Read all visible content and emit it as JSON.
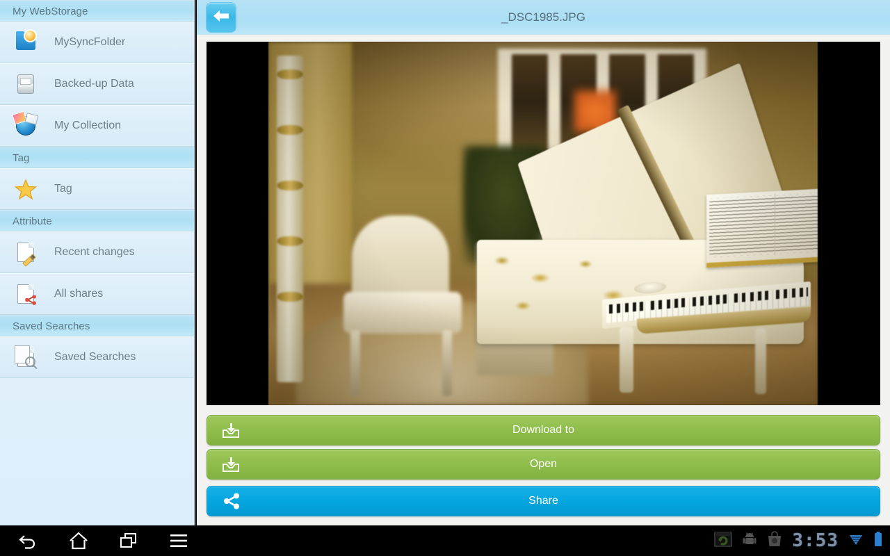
{
  "sidebar": {
    "sections": [
      {
        "title": "My WebStorage",
        "items": [
          {
            "label": "MySyncFolder",
            "icon": "sync-folder-icon"
          },
          {
            "label": "Backed-up Data",
            "icon": "backup-drive-icon"
          },
          {
            "label": "My Collection",
            "icon": "collection-globe-icon"
          }
        ]
      },
      {
        "title": "Tag",
        "items": [
          {
            "label": "Tag",
            "icon": "star-icon"
          }
        ]
      },
      {
        "title": "Attribute",
        "items": [
          {
            "label": "Recent changes",
            "icon": "document-pencil-icon"
          },
          {
            "label": "All shares",
            "icon": "document-share-icon"
          }
        ]
      },
      {
        "title": "Saved Searches",
        "items": [
          {
            "label": "Saved Searches",
            "icon": "document-search-icon"
          }
        ]
      }
    ]
  },
  "header": {
    "back_icon": "arrow-left-icon",
    "title": "_DSC1985.JPG"
  },
  "viewer": {
    "photo_alt": "white grand piano with gold ornamentation and sheet music",
    "letterbox_color": "#000000"
  },
  "actions": [
    {
      "label": "Download to",
      "icon": "download-tray-icon",
      "style": "green",
      "color": "#8fbe4c"
    },
    {
      "label": "Open",
      "icon": "download-tray-icon",
      "style": "green",
      "color": "#8fbe4c"
    },
    {
      "label": "Share",
      "icon": "share-nodes-icon",
      "style": "blue",
      "color": "#05a6e0"
    }
  ],
  "navbar": {
    "buttons": [
      {
        "name": "back-icon"
      },
      {
        "name": "home-icon"
      },
      {
        "name": "recents-icon"
      },
      {
        "name": "menu-icon"
      }
    ],
    "status_icons": [
      {
        "name": "screenshot-sync-icon"
      },
      {
        "name": "android-robot-icon"
      },
      {
        "name": "play-store-bag-icon"
      }
    ],
    "clock": "3:53",
    "wifi_icon": "wifi-signal-icon",
    "battery_icon": "battery-icon",
    "accent_color": "#3d8fd8"
  }
}
